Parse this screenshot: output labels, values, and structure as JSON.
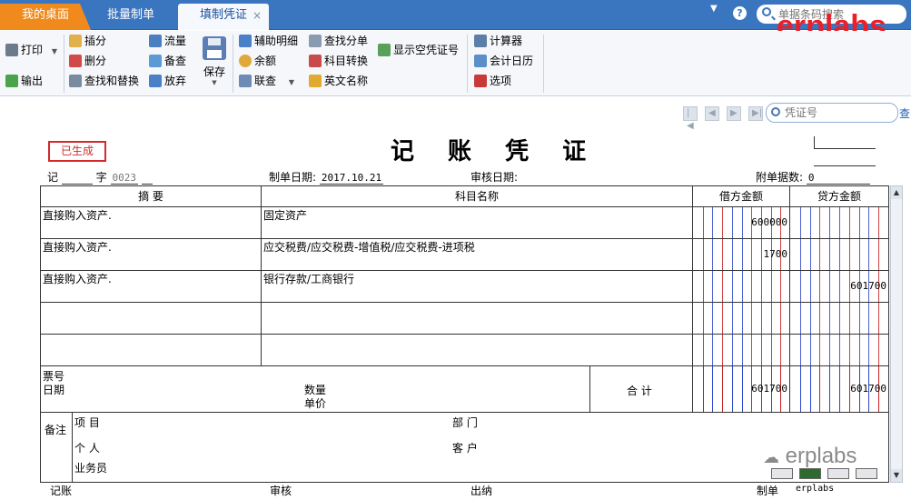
{
  "tabs": [
    {
      "label": "我的桌面"
    },
    {
      "label": "批量制单"
    },
    {
      "label": "填制凭证",
      "close": "×"
    }
  ],
  "top_search": {
    "placeholder": "单据条码搜索"
  },
  "watermark": "erplabs",
  "toolbar": {
    "print": "打印",
    "output": "输出",
    "insert": "插分",
    "delete": "删分",
    "find_replace": "查找和替换",
    "flow": "流量",
    "backup": "备查",
    "abandon": "放弃",
    "save": "保存",
    "aux_detail": "辅助明细",
    "balance": "余额",
    "link_query": "联查",
    "find_split": "查找分单",
    "subject_convert": "科目转换",
    "english_name": "英文名称",
    "show_empty_voucher": "显示空凭证号",
    "calculator": "计算器",
    "calendar": "会计日历",
    "options": "选项"
  },
  "voucher_search": {
    "placeholder": "凭证号",
    "link": "查"
  },
  "voucher": {
    "status_badge": "已生成",
    "title": "记 账 凭 证",
    "type_label": "记",
    "number_label": "字",
    "number": "0023",
    "date_label": "制单日期:",
    "date": "2017.10.21",
    "audit_date_label": "审核日期:",
    "attachments_label": "附单据数:",
    "attachments": "0"
  },
  "table": {
    "headers": {
      "summary": "摘 要",
      "subject": "科目名称",
      "debit": "借方金额",
      "credit": "贷方金额"
    },
    "rows": [
      {
        "summary": "直接购入资产.",
        "subject": "固定资产",
        "debit": "600000",
        "credit": ""
      },
      {
        "summary": "直接购入资产.",
        "subject": "应交税费/应交税费-增值税/应交税费-进项税",
        "debit": "1700",
        "credit": ""
      },
      {
        "summary": "直接购入资产.",
        "subject": "银行存款/工商银行",
        "debit": "",
        "credit": "601700"
      },
      {
        "summary": "",
        "subject": "",
        "debit": "",
        "credit": ""
      },
      {
        "summary": "",
        "subject": "",
        "debit": "",
        "credit": ""
      }
    ],
    "ticket_no_label": "票号",
    "date_label": "日期",
    "quantity_label": "数量",
    "unit_price_label": "单价",
    "total_label": "合 计",
    "total_debit": "601700",
    "total_credit": "601700",
    "remarks_label": "备注",
    "project_label": "项  目",
    "person_label": "个  人",
    "salesperson_label": "业务员",
    "department_label": "部  门",
    "customer_label": "客  户"
  },
  "footer": {
    "bookkeeping": "记账",
    "audit": "审核",
    "cashier": "出纳",
    "maker_label": "制单",
    "maker": "erplabs"
  },
  "wechat_mark": "erplabs",
  "colors": {
    "tabbar": "#3a75c0",
    "home_tab": "#f08a1c",
    "status_red": "#d32a2a",
    "watermark_red": "#e8202a"
  }
}
